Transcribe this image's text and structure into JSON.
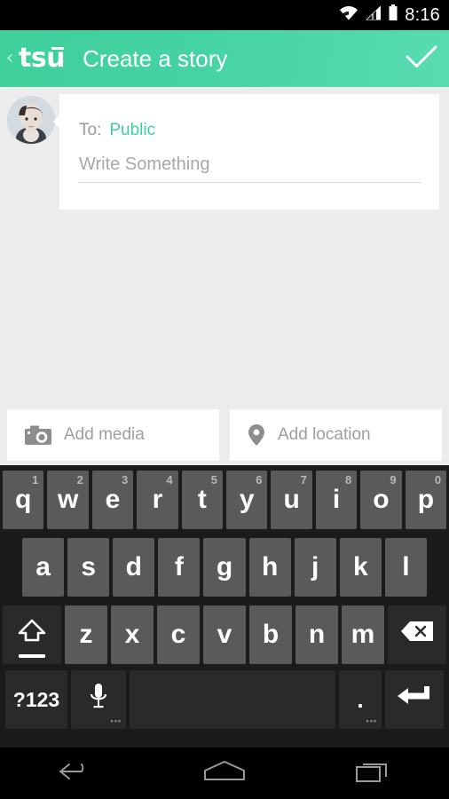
{
  "status_bar": {
    "time": "8:16",
    "icons": [
      "wifi-icon",
      "cellular-signal-icon",
      "battery-icon"
    ]
  },
  "app_bar": {
    "back_label": "‹",
    "logo_text": "tsu",
    "title": "Create a story",
    "confirm_icon": "check-icon",
    "background_color": "#3ecf9a"
  },
  "composer": {
    "avatar_alt": "user-avatar",
    "to_label": "To:",
    "to_value": "Public",
    "to_value_color": "#3ecf9a",
    "message_placeholder": "Write Something",
    "message_value": ""
  },
  "actions": [
    {
      "name": "add-media",
      "label": "Add media",
      "icon": "camera-icon"
    },
    {
      "name": "add-location",
      "label": "Add location",
      "icon": "location-pin-icon"
    }
  ],
  "keyboard": {
    "row1": [
      {
        "key": "q",
        "sup": "1"
      },
      {
        "key": "w",
        "sup": "2"
      },
      {
        "key": "e",
        "sup": "3"
      },
      {
        "key": "r",
        "sup": "4"
      },
      {
        "key": "t",
        "sup": "5"
      },
      {
        "key": "y",
        "sup": "6"
      },
      {
        "key": "u",
        "sup": "7"
      },
      {
        "key": "i",
        "sup": "8"
      },
      {
        "key": "o",
        "sup": "9"
      },
      {
        "key": "p",
        "sup": "0"
      }
    ],
    "row2": [
      {
        "key": "a"
      },
      {
        "key": "s"
      },
      {
        "key": "d"
      },
      {
        "key": "f"
      },
      {
        "key": "g"
      },
      {
        "key": "h"
      },
      {
        "key": "j"
      },
      {
        "key": "k"
      },
      {
        "key": "l"
      }
    ],
    "row3": [
      {
        "key": "z"
      },
      {
        "key": "x"
      },
      {
        "key": "c"
      },
      {
        "key": "v"
      },
      {
        "key": "b"
      },
      {
        "key": "n"
      },
      {
        "key": "m"
      }
    ],
    "shift_icon": "shift-icon",
    "backspace_icon": "backspace-icon",
    "symbols_label": "?123",
    "mic_icon": "microphone-icon",
    "space_label": "",
    "period_label": ".",
    "enter_icon": "enter-icon",
    "hint_dots": "•••"
  },
  "nav_bar": {
    "back_icon": "nav-back-icon",
    "home_icon": "nav-home-icon",
    "recents_icon": "nav-recents-icon"
  }
}
